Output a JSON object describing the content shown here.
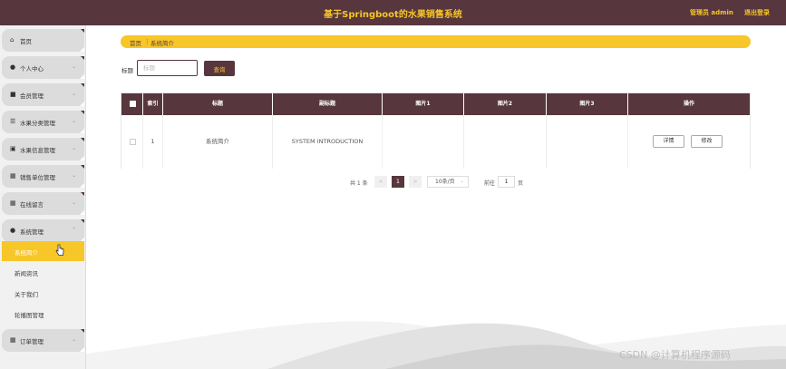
{
  "header": {
    "title": "基于Springboot的水果销售系统",
    "admin": "管理员 admin",
    "logout": "退出登录"
  },
  "sidebar": {
    "items": [
      {
        "label": "首页",
        "icon": "home-icon"
      },
      {
        "label": "个人中心",
        "icon": "user-icon"
      },
      {
        "label": "会员管理",
        "icon": "member-icon"
      },
      {
        "label": "水果分类管理",
        "icon": "category-icon"
      },
      {
        "label": "水果信息管理",
        "icon": "fruit-icon"
      },
      {
        "label": "销售单位管理",
        "icon": "grid-icon"
      },
      {
        "label": "在线留言",
        "icon": "message-icon"
      },
      {
        "label": "系统管理",
        "icon": "system-icon"
      }
    ],
    "subitems": [
      {
        "label": "系统简介"
      },
      {
        "label": "新闻资讯"
      },
      {
        "label": "关于我们"
      },
      {
        "label": "轮播图管理"
      }
    ],
    "last_item": {
      "label": "订单管理",
      "icon": "order-icon"
    }
  },
  "breadcrumb": {
    "home": "首页",
    "separator": "⋮",
    "current": "系统简介"
  },
  "search": {
    "label": "标题",
    "placeholder": "标题",
    "button": "查询"
  },
  "table": {
    "columns": [
      "索引",
      "标题",
      "副标题",
      "图片1",
      "图片2",
      "图片3",
      "操作"
    ],
    "rows": [
      {
        "index": "1",
        "title": "系统简介",
        "subtitle": "SYSTEM INTRODUCTION",
        "img1": "",
        "img2": "",
        "img3": ""
      }
    ],
    "detail_button": "详情",
    "edit_button": "修改"
  },
  "pagination": {
    "total": "共 1 条",
    "prev": "<",
    "page": "1",
    "next": ">",
    "page_size": "10条/页",
    "goto_label": "前往",
    "goto_value": "1",
    "goto_unit": "页"
  },
  "watermark": "CSDN @计算机程序源码",
  "colors": {
    "primary": "#57363d",
    "accent": "#f7c628"
  }
}
